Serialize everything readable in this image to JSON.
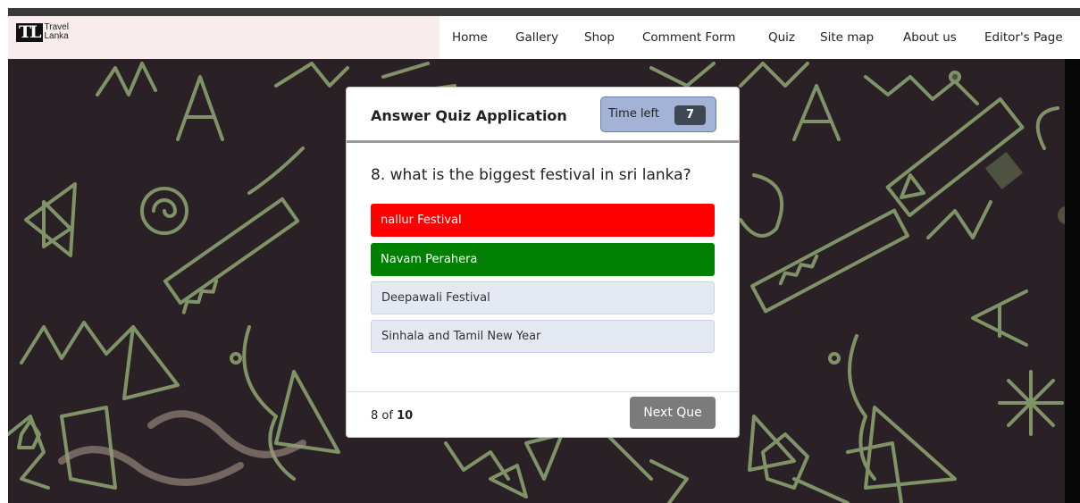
{
  "brand": {
    "mark": "TL",
    "line1": "Travel",
    "line2": "Lanka"
  },
  "nav": {
    "items": [
      "Home",
      "Gallery",
      "Shop",
      "Comment Form",
      "Quiz",
      "Site map",
      "About us",
      "Editor's Page"
    ]
  },
  "quiz": {
    "title": "Answer Quiz Application",
    "timer_label": "Time left",
    "timer_value": "7",
    "question": "8. what is the biggest festival in sri lanka?",
    "options": [
      {
        "label": "nallur Festival",
        "state": "wrong"
      },
      {
        "label": "Navam Perahera",
        "state": "correct"
      },
      {
        "label": "Deepawali Festival",
        "state": "neutral"
      },
      {
        "label": "Sinhala and Tamil New Year",
        "state": "neutral"
      }
    ],
    "progress_current": "8",
    "progress_of": "of",
    "progress_total": "10",
    "next_label": "Next Que"
  },
  "colors": {
    "wrong": "#ff0000",
    "correct": "#008000",
    "neutral": "#e4e9f1",
    "background": "#2a2127",
    "chalk": "#8fa872"
  },
  "icons": {
    "background_pattern": "chalkboard-doodle-pattern"
  }
}
